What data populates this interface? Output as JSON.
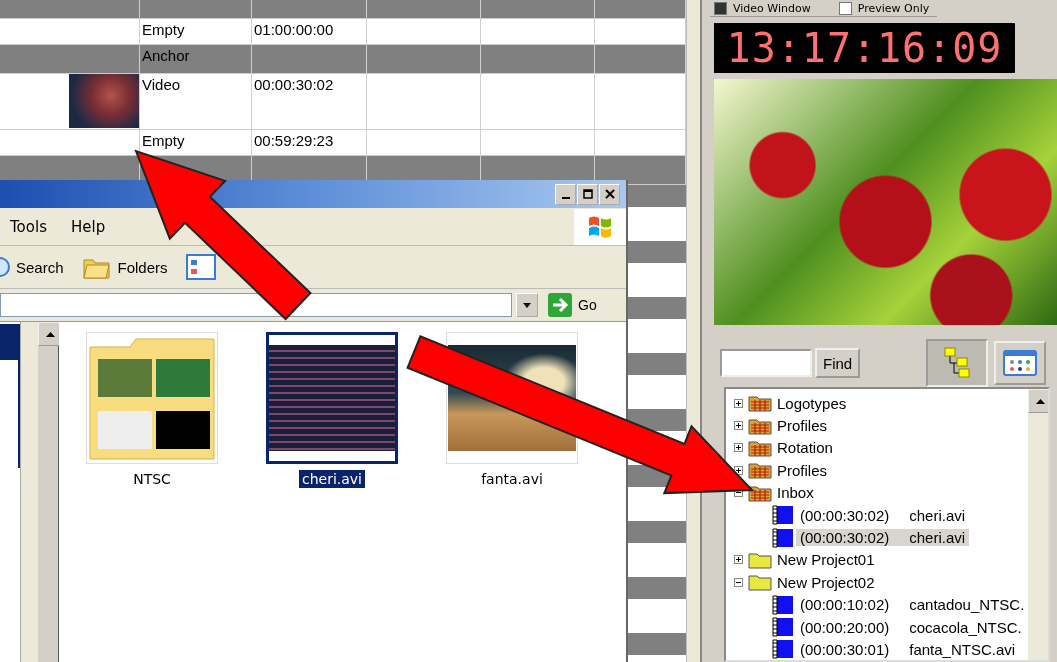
{
  "timeline": {
    "rows": [
      {
        "kind": "anchor"
      },
      {
        "kind": "clip",
        "type": "Empty",
        "time": "01:00:00:00"
      },
      {
        "kind": "anchor",
        "label": "Anchor"
      },
      {
        "kind": "video",
        "type": "Video",
        "time": "00:00:30:02"
      },
      {
        "kind": "clip",
        "type": "Empty",
        "time": "00:59:29:23"
      },
      {
        "kind": "anchor"
      }
    ]
  },
  "explorer": {
    "menu": [
      "Tools",
      "Help"
    ],
    "toolbar": [
      {
        "kind": "search",
        "label": "Search"
      },
      {
        "kind": "folders",
        "label": "Folders"
      }
    ],
    "go_label": "Go",
    "files": [
      {
        "kind": "folder",
        "label": "NTSC",
        "selected": false
      },
      {
        "kind": "video",
        "label": "cheri.avi",
        "selected": true
      },
      {
        "kind": "image",
        "label": "fanta.avi",
        "selected": false
      }
    ]
  },
  "preview": {
    "checkboxes": [
      {
        "label": "Video Window",
        "checked": true
      },
      {
        "label": "Preview Only",
        "checked": false
      }
    ],
    "timecode": "13:17:16:09"
  },
  "library": {
    "find_label": "Find",
    "tree": [
      {
        "kind": "bin",
        "label": "Logotypes",
        "expanded": false
      },
      {
        "kind": "bin",
        "label": "Profiles",
        "expanded": false
      },
      {
        "kind": "bin",
        "label": "Rotation",
        "expanded": false
      },
      {
        "kind": "bin",
        "label": "Profiles",
        "expanded": false
      },
      {
        "kind": "bin",
        "label": "Inbox",
        "expanded": true,
        "children": [
          {
            "time": "(00:00:30:02)",
            "name": "cheri.avi",
            "selected": false
          },
          {
            "time": "(00:00:30:02)",
            "name": "cheri.avi",
            "selected": true
          }
        ]
      },
      {
        "kind": "project",
        "label": "New Project01",
        "expanded": false
      },
      {
        "kind": "project",
        "label": "New Project02",
        "expanded": true,
        "children": [
          {
            "time": "(00:00:10:02)",
            "name": "cantadou_NTSC.",
            "selected": false
          },
          {
            "time": "(00:00:20:00)",
            "name": "cocacola_NTSC.",
            "selected": false
          },
          {
            "time": "(00:00:30:01)",
            "name": "fanta_NTSC.avi",
            "selected": false
          }
        ]
      }
    ]
  }
}
